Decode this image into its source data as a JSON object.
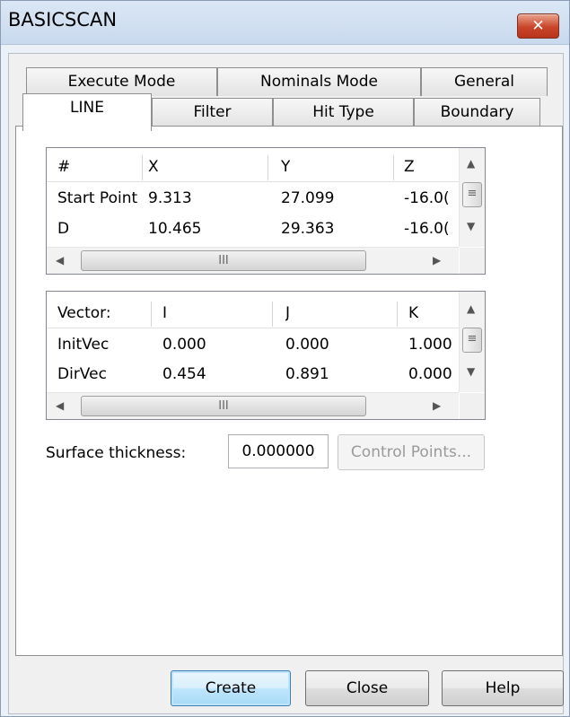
{
  "window": {
    "title": "BASICSCAN",
    "close_glyph": "✕"
  },
  "tabs": {
    "row1": [
      "Execute Mode",
      "Nominals Mode",
      "General"
    ],
    "row2": [
      "LINE",
      "Filter",
      "Hit Type",
      "Boundary"
    ],
    "active": "LINE"
  },
  "points_grid": {
    "headers": [
      "#",
      "X",
      "Y",
      "Z"
    ],
    "rows": [
      [
        "Start Point",
        "9.313",
        "27.099",
        "-16.0("
      ],
      [
        "D",
        "10.465",
        "29.363",
        "-16.0("
      ]
    ]
  },
  "vector_grid": {
    "headers": [
      "Vector:",
      "I",
      "J",
      "K"
    ],
    "rows": [
      [
        "InitVec",
        "0.000",
        "0.000",
        "1.000"
      ],
      [
        "DirVec",
        "0.454",
        "0.891",
        "0.000"
      ]
    ]
  },
  "scroll": {
    "up": "▲",
    "down": "▼",
    "left": "◀",
    "right": "▶",
    "thumb_grip": "III",
    "vthumb_grip": "≡"
  },
  "surface_thickness": {
    "label": "Surface thickness:",
    "value": "0.000000"
  },
  "control_points_label": "Control Points...",
  "footer": {
    "create": "Create",
    "close": "Close",
    "help": "Help"
  }
}
